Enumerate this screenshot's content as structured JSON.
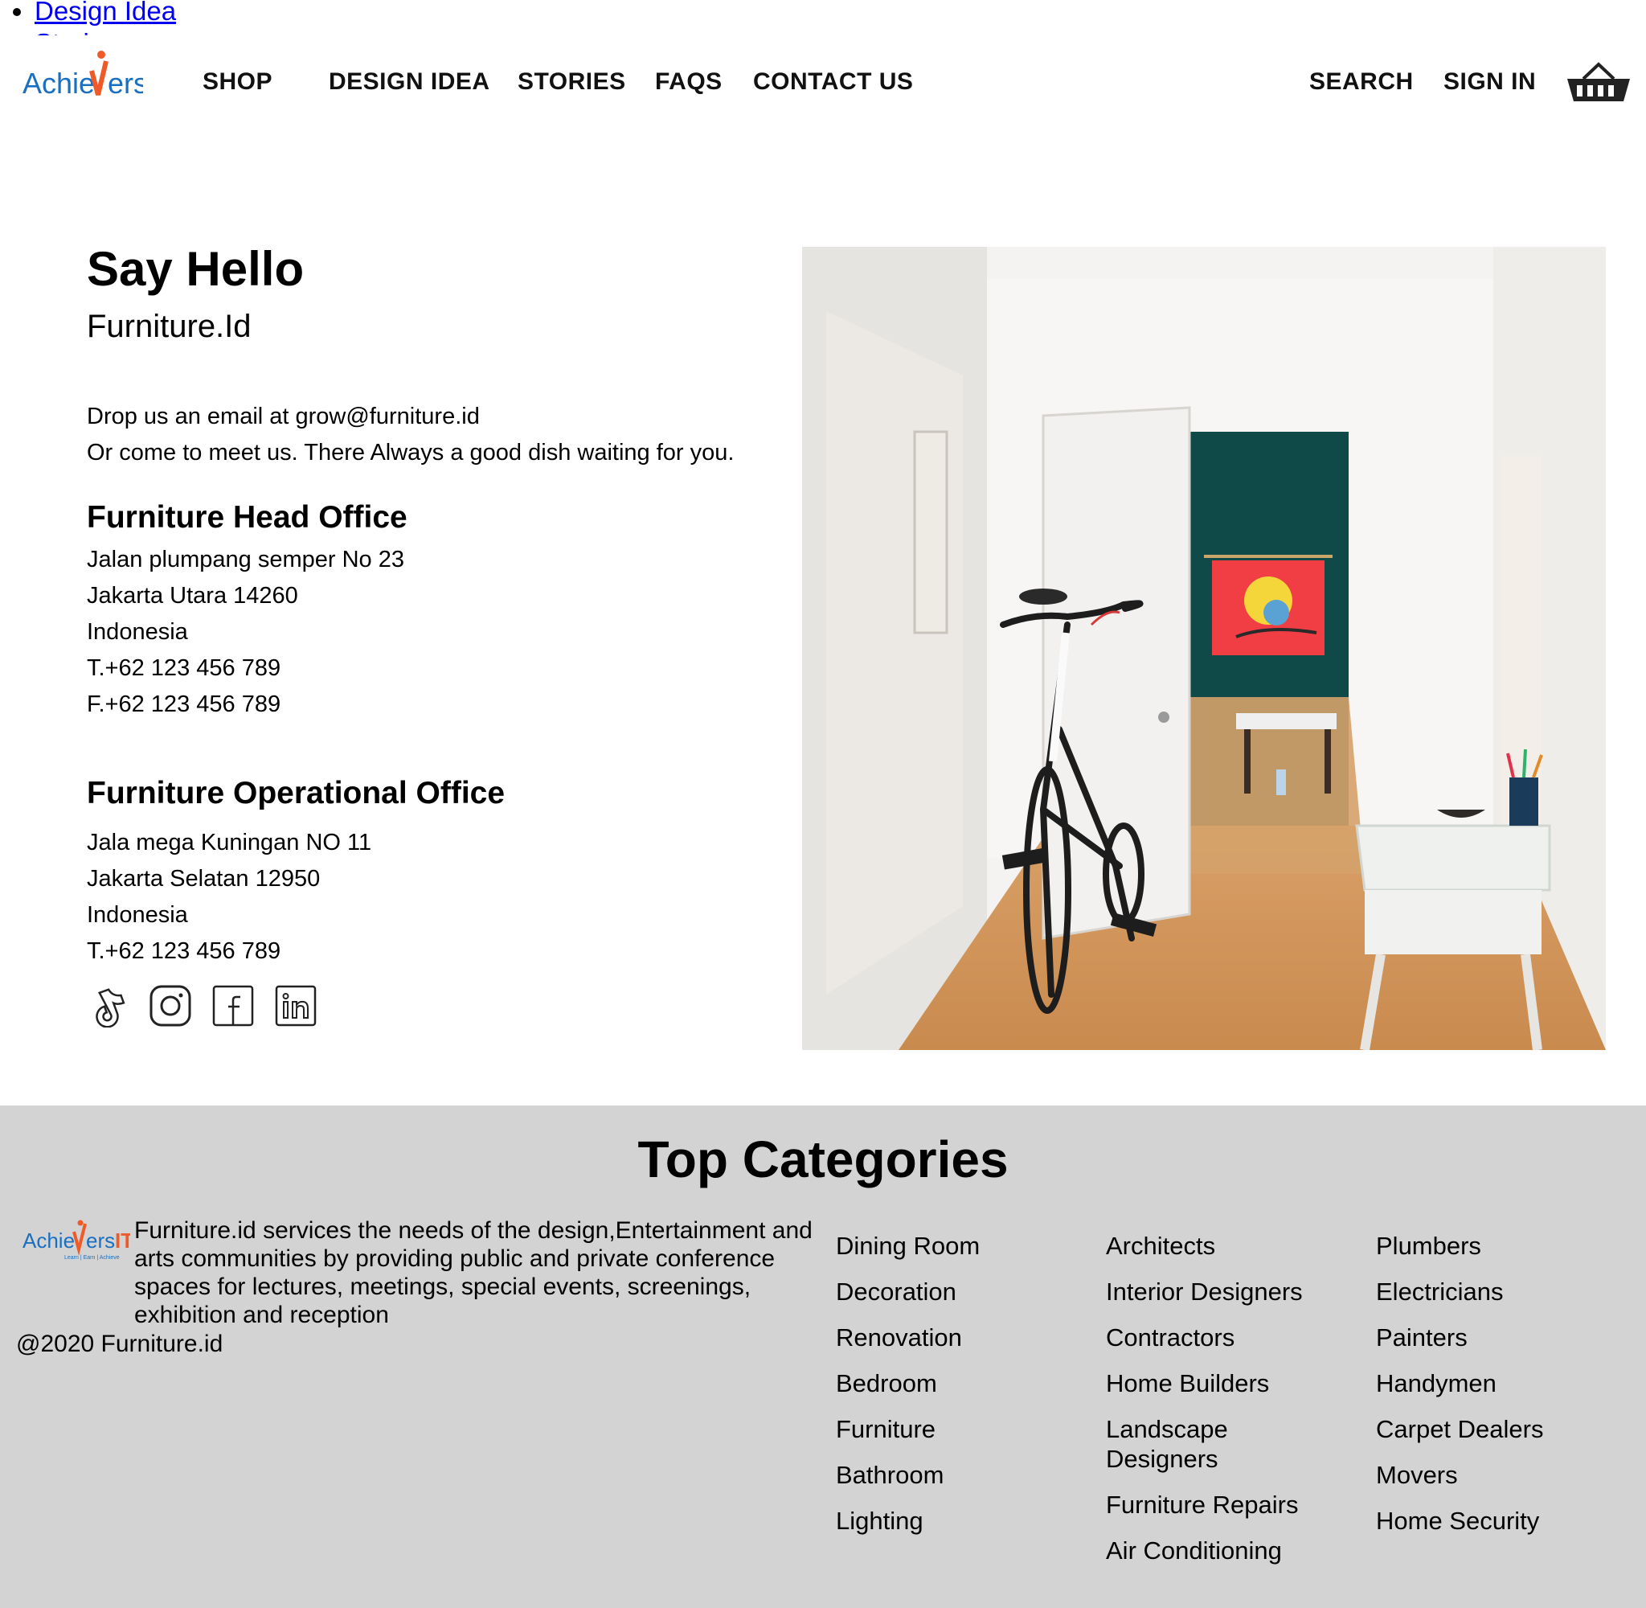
{
  "stray_list": {
    "items": [
      "Design Idea",
      "Stories"
    ]
  },
  "header": {
    "logo_text_a": "Achie",
    "logo_text_b": "ers",
    "logo_text_c": "IT",
    "nav": [
      "SHOP",
      "DESIGN IDEA",
      "STORIES",
      "FAQS",
      "CONTACT US"
    ],
    "search_label": "SEARCH",
    "signin_label": "SIGN IN"
  },
  "main": {
    "title": "Say Hello",
    "subtitle": "Furniture.Id",
    "intro": [
      "Drop us an email at grow@furniture.id",
      "Or come to meet us. There Always a good dish waiting for you."
    ],
    "head_office": {
      "title": "Furniture Head Office",
      "lines": [
        "Jalan plumpang semper No 23",
        "Jakarta Utara 14260",
        "Indonesia",
        "T.+62 123 456 789",
        "F.+62 123 456 789"
      ]
    },
    "operational_office": {
      "title": "Furniture Operational Office",
      "lines": [
        "Jala mega Kuningan NO 11",
        "Jakarta Selatan 12950",
        "Indonesia",
        "T.+62 123 456 789"
      ]
    },
    "social_icons": [
      "tiktok-icon",
      "instagram-icon",
      "facebook-icon",
      "linkedin-icon"
    ]
  },
  "footer": {
    "title": "Top Categories",
    "logo_tagline": "Learn | Earn | Achieve",
    "description": "Furniture.id services the needs of the design,Entertainment and arts communities by providing public and private conference spaces for lectures, meetings, special events, screenings, exhibition and reception",
    "copyright": "@2020 Furniture.id",
    "categories": {
      "col1": [
        "Dining Room",
        "Decoration",
        "Renovation",
        "Bedroom",
        "Furniture",
        "Bathroom",
        "Lighting"
      ],
      "col2": [
        "Architects",
        "Interior Designers",
        "Contractors",
        "Home Builders",
        "Landscape Designers",
        "Furniture Repairs",
        "Air Conditioning"
      ],
      "col3": [
        "Plumbers",
        "Electricians",
        "Painters",
        "Handymen",
        "Carpet Dealers",
        "Movers",
        "Home Security"
      ]
    }
  },
  "colors": {
    "brand_blue": "#1a6fc0",
    "brand_orange": "#f05a28",
    "footer_bg": "#d3d3d3",
    "link_blue": "#0000ee"
  }
}
